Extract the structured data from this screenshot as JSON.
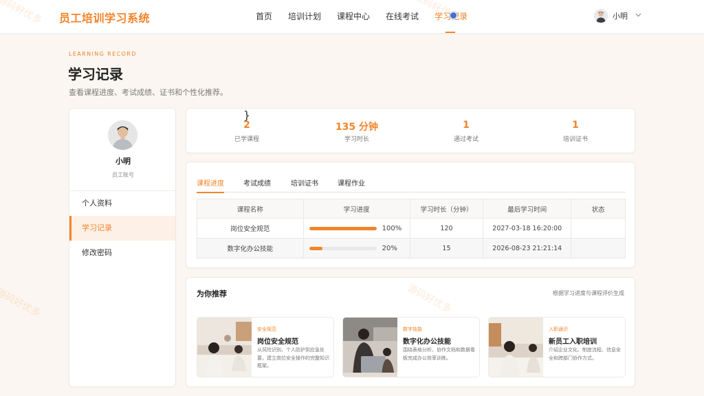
{
  "app": {
    "title": "员工培训学习系统"
  },
  "nav": {
    "items": [
      {
        "label": "首页"
      },
      {
        "label": "培训计划"
      },
      {
        "label": "课程中心"
      },
      {
        "label": "在线考试"
      },
      {
        "label": "学习记录"
      }
    ],
    "active_index": 4
  },
  "user": {
    "name": "小明",
    "chevron_icon": "chevron-down-icon"
  },
  "header": {
    "eyebrow": "LEARNING RECORD",
    "title": "学习记录",
    "subtitle": "查看课程进度、考试成绩、证书和个性化推荐。"
  },
  "profile": {
    "name": "小明",
    "role": "员工账号",
    "menu": [
      {
        "label": "个人资料"
      },
      {
        "label": "学习记录"
      },
      {
        "label": "修改密码"
      }
    ]
  },
  "stats": [
    {
      "value": "2",
      "label": "已学课程"
    },
    {
      "value": "135 分钟",
      "label": "学习时长"
    },
    {
      "value": "1",
      "label": "通过考试"
    },
    {
      "value": "1",
      "label": "培训证书"
    }
  ],
  "tabs": [
    {
      "label": "课程进度"
    },
    {
      "label": "考试成绩"
    },
    {
      "label": "培训证书"
    },
    {
      "label": "课程作业"
    }
  ],
  "table": {
    "headers": [
      "课程名称",
      "学习进度",
      "学习时长（分钟）",
      "最后学习时间",
      "状态"
    ],
    "rows": [
      {
        "name": "岗位安全规范",
        "progress": 100,
        "progress_label": "100%",
        "minutes": "120",
        "last": "2027-03-18 16:20:00",
        "status": ""
      },
      {
        "name": "数字化办公技能",
        "progress": 20,
        "progress_label": "20%",
        "minutes": "15",
        "last": "2026-08-23 21:21:14",
        "status": ""
      }
    ]
  },
  "recommend": {
    "title": "为你推荐",
    "note": "根据学习进度与课程评价生成",
    "items": [
      {
        "tag": "安全规范",
        "name": "岗位安全规范",
        "desc": "从风险识别、个人防护到应急处置，建立岗位安全操作的完整知识框架。"
      },
      {
        "tag": "数字技能",
        "name": "数字化办公技能",
        "desc": "围绕表格分析、协作文档和数据看板完成办公效率训练。"
      },
      {
        "tag": "入职通识",
        "name": "新员工入职培训",
        "desc": "介绍企业文化、制度流程、信息安全和跨部门协作方式。"
      }
    ]
  },
  "colors": {
    "accent": "#f2842a",
    "background": "#fbf6f1"
  }
}
